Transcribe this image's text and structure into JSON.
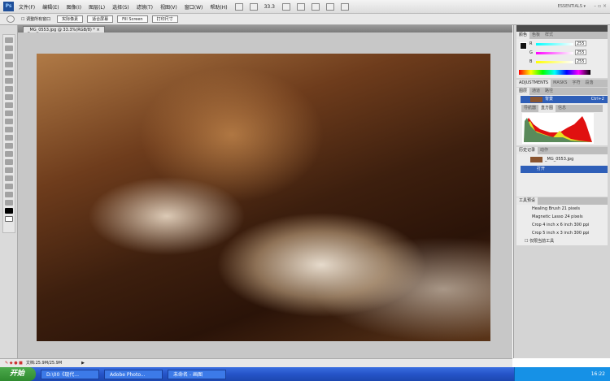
{
  "menubar": {
    "menus": [
      "文件(F)",
      "编辑(E)",
      "图像(I)",
      "图层(L)",
      "选择(S)",
      "滤镜(T)",
      "视图(V)",
      "窗口(W)",
      "帮助(H)"
    ],
    "zoom": "33.3",
    "workspace": "ESSENTIALS ▾",
    "window_controls": "– ▫ ×"
  },
  "optbar": {
    "checkbox_label": "调整所有窗口",
    "buttons": [
      "实际像素",
      "适合屏幕",
      "Fill Screen",
      "打印尺寸"
    ]
  },
  "document": {
    "tab": "_MG_0553.jpg @ 33.3%(RGB/8) * ×"
  },
  "color_panel": {
    "tabs": [
      "颜色",
      "色板",
      "样式"
    ],
    "channels": [
      {
        "label": "R",
        "value": "255"
      },
      {
        "label": "G",
        "value": "255"
      },
      {
        "label": "B",
        "value": "255"
      }
    ]
  },
  "adjustments": {
    "tabs": [
      "ADJUSTMENTS",
      "MASKS",
      "字符",
      "段落"
    ]
  },
  "layers": {
    "tabs": [
      "图层",
      "通道",
      "路径"
    ],
    "layer": "背景",
    "shortcut": "Ctrl+2"
  },
  "histogram": {
    "tabs": [
      "导航器",
      "直方图",
      "信息"
    ]
  },
  "history": {
    "tabs": [
      "历史记录",
      "动作"
    ],
    "items": [
      "_MG_0553.jpg",
      "打开"
    ]
  },
  "tool_presets": {
    "tab": "工具预设",
    "items": [
      "Healing Brush 21 pixels",
      "Magnetic Lasso 24 pixels",
      "Crop 4 inch x 6 inch 300 ppi",
      "Crop 5 inch x 3 inch 300 ppi"
    ],
    "checkbox": "仅限当前工具"
  },
  "status": {
    "text": "文档:25.9M/25.9M"
  },
  "taskbar": {
    "start": "开始",
    "tasks": [
      "D:\\00《现代...",
      "Adobe Photo...",
      "未命名 - 画图"
    ],
    "time": "16:22"
  }
}
